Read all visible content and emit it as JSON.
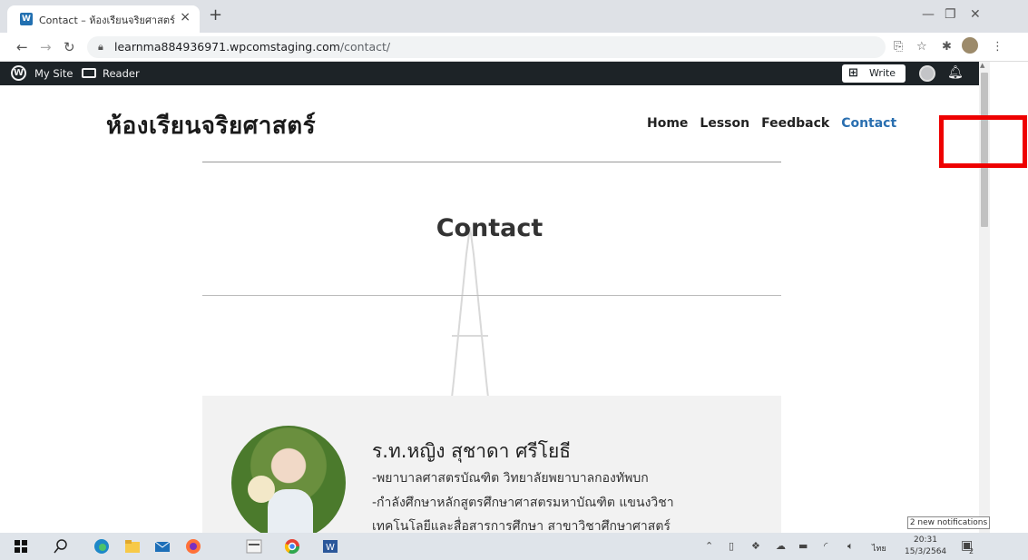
{
  "browser": {
    "tab_title": "Contact – ห้องเรียนจริยศาสตร์",
    "tab_close": "×",
    "new_tab": "+",
    "url_host": "learnma884936971.wpcomstaging.com",
    "url_path": "/contact/",
    "window_min": "—",
    "window_restore": "❐",
    "window_close": "✕"
  },
  "wp_admin_bar": {
    "my_site": "My Site",
    "reader": "Reader",
    "write": "Write"
  },
  "site": {
    "title": "ห้องเรียนจริยศาสตร์",
    "nav": [
      "Home",
      "Lesson",
      "Feedback",
      "Contact"
    ],
    "active_nav": "Contact"
  },
  "page": {
    "heading": "Contact"
  },
  "profile": {
    "name": "ร.ท.หญิง สุชาดา ศรีโยธี",
    "details": [
      "-พยาบาลศาสตรบัณฑิต วิทยาลัยพยาบาลกองทัพบก",
      "-กำลังศึกษาหลักสูตรศึกษาศาสตรมหาบัณฑิต แขนงวิชา",
      "เทคโนโลยีและสื่อสารการศึกษา สาขาวิชาศึกษาศาสตร์"
    ]
  },
  "notification": "2 new notifications",
  "taskbar": {
    "lang": "ไทย",
    "time": "20:31",
    "date": "15/3/2564",
    "notif_count": "2"
  },
  "colors": {
    "wp_bar": "#1d2327",
    "accent_link": "#2a6fb0",
    "annotation": "#ee0000"
  }
}
